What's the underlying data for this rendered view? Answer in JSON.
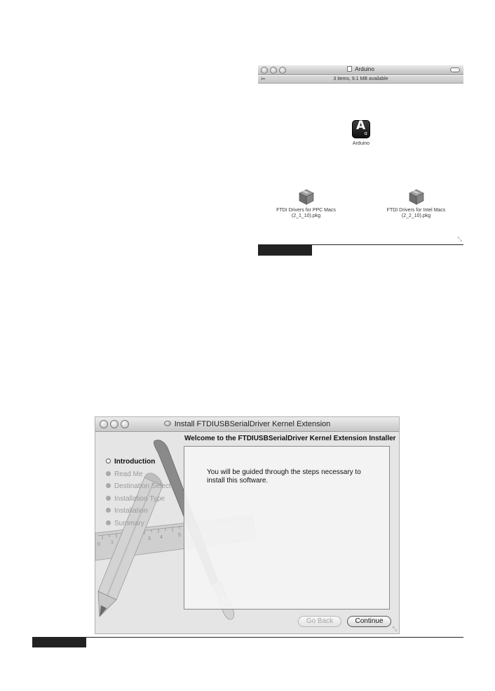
{
  "finder": {
    "title": "Arduino",
    "status": "3 items, 9.1 MB available",
    "items": [
      {
        "label_line1": "Arduino",
        "label_line2": ""
      },
      {
        "label_line1": "FTDI Drivers for PPC Macs",
        "label_line2": "(2_1_10).pkg"
      },
      {
        "label_line1": "FTDI Drivers for Intel Macs",
        "label_line2": "(2_2_10).pkg"
      }
    ],
    "app_icon_letter": "A",
    "app_icon_small": "α"
  },
  "installer": {
    "title": "Install FTDIUSBSerialDriver Kernel Extension",
    "heading": "Welcome to the FTDIUSBSerialDriver Kernel Extension Installer",
    "steps": [
      {
        "label": "Introduction",
        "current": true
      },
      {
        "label": "Read Me"
      },
      {
        "label": "Destination Select"
      },
      {
        "label": "Installation Type"
      },
      {
        "label": "Installation"
      },
      {
        "label": "Summary"
      }
    ],
    "body_text": "You will be guided through the steps necessary to install this software.",
    "buttons": {
      "back": "Go Back",
      "continue": "Continue"
    },
    "ruler_numbers": [
      "0",
      "1",
      "2",
      "3",
      "4",
      "5"
    ]
  },
  "colors": {
    "window_bg": "#e5e5e5",
    "titlebar_top": "#ececec",
    "titlebar_bottom": "#c7c7c7",
    "caption_bar": "#222222"
  },
  "icons": [
    "close-button-icon",
    "minimize-button-icon",
    "zoom-button-icon",
    "document-icon",
    "toolbar-toggle-icon",
    "action-tool-icon",
    "arduino-app-icon",
    "package-icon",
    "disk-icon",
    "resize-grip-icon",
    "step-bullet-icon",
    "pencil-illustration",
    "brush-illustration",
    "ruler-illustration"
  ]
}
